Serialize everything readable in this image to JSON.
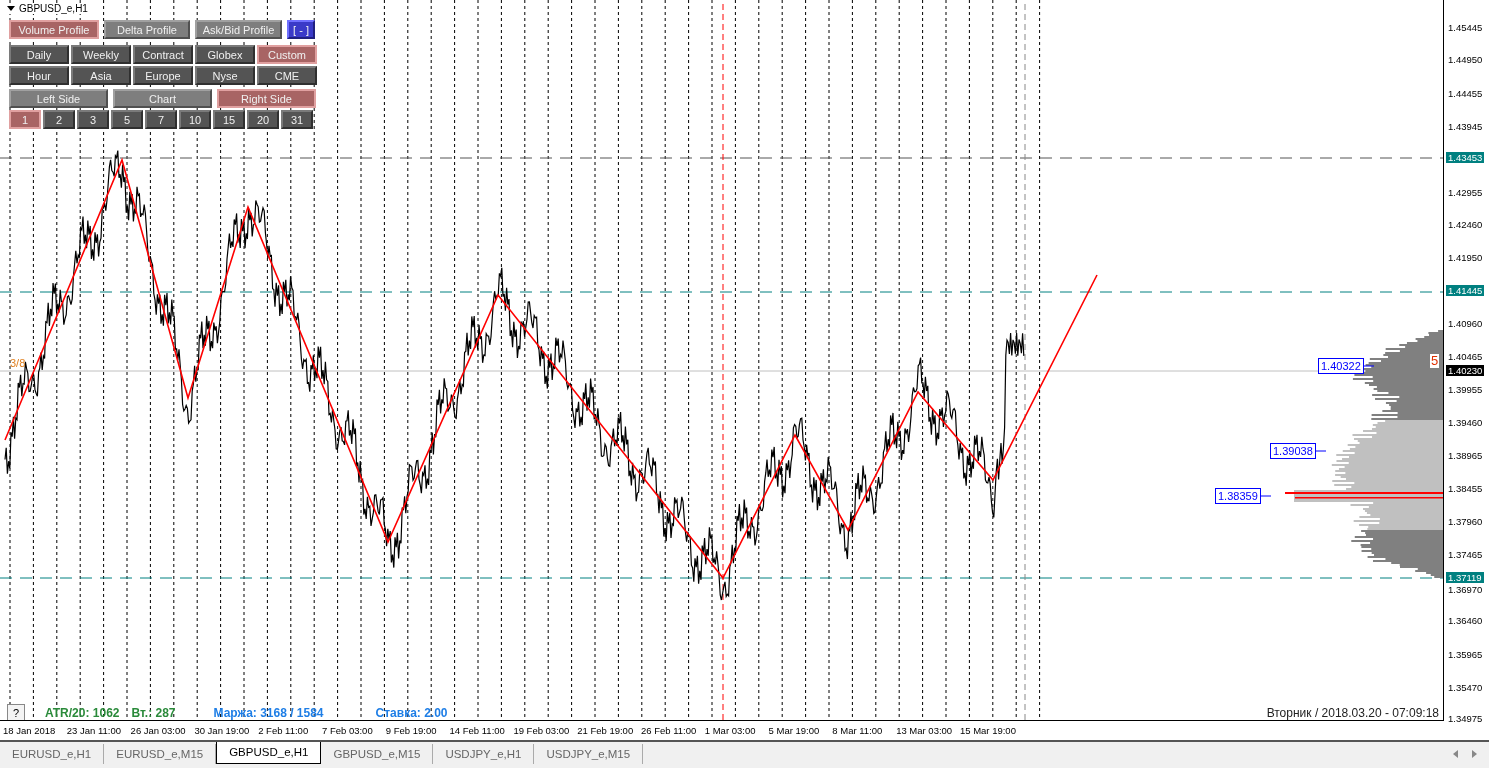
{
  "chart_title": "GBPUSD_e,H1",
  "button_rows": [
    {
      "kind": "light",
      "buttons": [
        {
          "label": "Volume Profile",
          "selected": true,
          "kind": "normal"
        },
        {
          "label": "Delta Profile",
          "selected": false,
          "kind": "normal"
        },
        {
          "label": "Ask/Bid Profile",
          "selected": false,
          "kind": "normal"
        },
        {
          "label": "[ - ]",
          "selected": false,
          "kind": "toggle"
        }
      ]
    },
    {
      "kind": "dark",
      "buttons": [
        {
          "label": "Daily",
          "selected": false,
          "kind": "normal"
        },
        {
          "label": "Weekly",
          "selected": false,
          "kind": "normal"
        },
        {
          "label": "Contract",
          "selected": false,
          "kind": "normal"
        },
        {
          "label": "Globex",
          "selected": false,
          "kind": "normal"
        },
        {
          "label": "Custom",
          "selected": true,
          "kind": "normal"
        }
      ]
    },
    {
      "kind": "dark",
      "buttons": [
        {
          "label": "Hour",
          "selected": false,
          "kind": "normal"
        },
        {
          "label": "Asia",
          "selected": false,
          "kind": "normal"
        },
        {
          "label": "Europe",
          "selected": false,
          "kind": "normal"
        },
        {
          "label": "Nyse",
          "selected": false,
          "kind": "normal"
        },
        {
          "label": "CME",
          "selected": false,
          "kind": "normal"
        }
      ]
    },
    {
      "kind": "light",
      "buttons": [
        {
          "label": "Left Side",
          "selected": false,
          "kind": "normal"
        },
        {
          "label": "Chart",
          "selected": false,
          "kind": "normal"
        },
        {
          "label": "Right Side",
          "selected": true,
          "kind": "normal"
        }
      ]
    },
    {
      "kind": "dark",
      "buttons": [
        {
          "label": "1",
          "selected": true,
          "kind": "normal"
        },
        {
          "label": "2",
          "selected": false,
          "kind": "normal"
        },
        {
          "label": "3",
          "selected": false,
          "kind": "normal"
        },
        {
          "label": "5",
          "selected": false,
          "kind": "normal"
        },
        {
          "label": "7",
          "selected": false,
          "kind": "normal"
        },
        {
          "label": "10",
          "selected": false,
          "kind": "normal"
        },
        {
          "label": "15",
          "selected": false,
          "kind": "normal"
        },
        {
          "label": "20",
          "selected": false,
          "kind": "normal"
        },
        {
          "label": "31",
          "selected": false,
          "kind": "normal"
        }
      ]
    }
  ],
  "fraction_label": "3/8",
  "profile_count": "5",
  "profile_levels": [
    "1.40322",
    "1.39038",
    "1.38359"
  ],
  "info": {
    "help": "?",
    "atr": "ATR/20: 1062",
    "tuesday_range": "Вт.: 287",
    "margin": "Маржа: 3168 / 1584",
    "rate": "Ставка: 2.00",
    "datetime": "Вторник / 2018.03.20 - 07:09:18"
  },
  "price_axis": [
    "1.45445",
    "1.44950",
    "1.44455",
    "1.43945",
    "1.43453",
    "1.42955",
    "1.42460",
    "1.41950",
    "1.41445",
    "1.40960",
    "1.40465",
    "1.40230",
    "1.39955",
    "1.39460",
    "1.38965",
    "1.38455",
    "1.37960",
    "1.37465",
    "1.37119",
    "1.36970",
    "1.36460",
    "1.35965",
    "1.35470",
    "1.34975"
  ],
  "price_markers": [
    {
      "kind": "regular"
    },
    {
      "kind": "regular"
    },
    {
      "kind": "regular"
    },
    {
      "kind": "regular"
    },
    {
      "kind": "level"
    },
    {
      "kind": "regular"
    },
    {
      "kind": "regular"
    },
    {
      "kind": "regular"
    },
    {
      "kind": "level"
    },
    {
      "kind": "regular"
    },
    {
      "kind": "regular"
    },
    {
      "kind": "current"
    },
    {
      "kind": "regular"
    },
    {
      "kind": "regular"
    },
    {
      "kind": "regular"
    },
    {
      "kind": "regular"
    },
    {
      "kind": "regular"
    },
    {
      "kind": "regular"
    },
    {
      "kind": "level"
    },
    {
      "kind": "regular"
    },
    {
      "kind": "regular"
    },
    {
      "kind": "regular"
    },
    {
      "kind": "regular"
    },
    {
      "kind": "regular"
    }
  ],
  "time_axis": [
    "18 Jan 2018",
    "23 Jan 11:00",
    "26 Jan 03:00",
    "30 Jan 19:00",
    "2 Feb 11:00",
    "7 Feb 03:00",
    "9 Feb 19:00",
    "14 Feb 11:00",
    "19 Feb 03:00",
    "21 Feb 19:00",
    "26 Feb 11:00",
    "1 Mar 03:00",
    "5 Mar 19:00",
    "8 Mar 11:00",
    "13 Mar 03:00",
    "15 Mar 19:00"
  ],
  "tabs": [
    {
      "label": "EURUSD_e,H1",
      "selected": false
    },
    {
      "label": "EURUSD_e,M15",
      "selected": false
    },
    {
      "label": "GBPUSD_e,H1",
      "selected": true
    },
    {
      "label": "GBPUSD_e,M15",
      "selected": false
    },
    {
      "label": "USDJPY_e,H1",
      "selected": false
    },
    {
      "label": "USDJPY_e,M15",
      "selected": false
    }
  ]
}
